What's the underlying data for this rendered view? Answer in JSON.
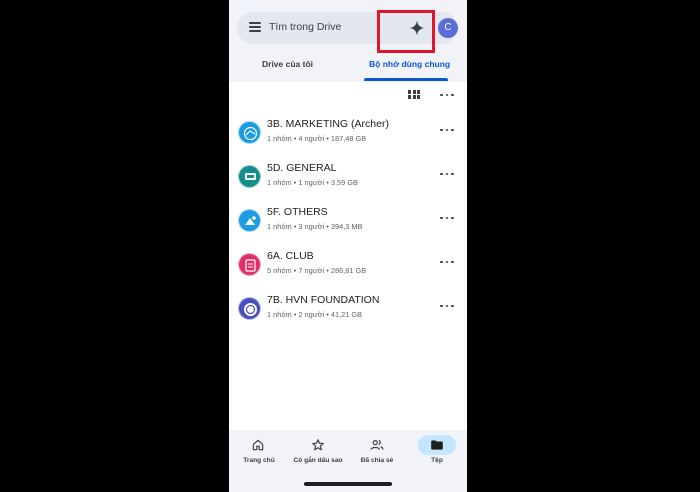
{
  "search": {
    "placeholder": "Tìm trong Drive",
    "avatar_letter": "C"
  },
  "tabs": [
    {
      "label": "Drive của tôi",
      "active": false
    },
    {
      "label": "Bộ nhớ dùng chung",
      "active": true
    }
  ],
  "toolbar": {
    "view_icon": "grid-view-icon",
    "more_icon": "more-horiz-icon"
  },
  "shared_drives": [
    {
      "name": "3B. MARKETING (Archer)",
      "meta": "1 nhóm • 4 người • 187,48 GB",
      "icon_color": "#1a9de0",
      "icon_text": ""
    },
    {
      "name": "5D. GENERAL",
      "meta": "1 nhóm • 1 người • 3,59 GB",
      "icon_color": "#128f8b",
      "icon_text": ""
    },
    {
      "name": "5F. OTHERS",
      "meta": "1 nhóm • 3 người • 394,3 MB",
      "icon_color": "#1d9be3",
      "icon_text": ""
    },
    {
      "name": "6A. CLUB",
      "meta": "5 nhóm • 7 người • 286,81 GB",
      "icon_color": "#e0306a",
      "icon_text": ""
    },
    {
      "name": "7B. HVN FOUNDATION",
      "meta": "1 nhóm • 2 người • 41,21 GB",
      "icon_color": "#4a4fbf",
      "icon_text": ""
    }
  ],
  "bottom_nav": [
    {
      "label": "Trang chủ",
      "icon": "home-icon",
      "active": false
    },
    {
      "label": "Có gắn dấu sao",
      "icon": "star-icon",
      "active": false
    },
    {
      "label": "Đã chia sẻ",
      "icon": "people-icon",
      "active": false
    },
    {
      "label": "Tệp",
      "icon": "folder-icon",
      "active": true
    }
  ],
  "colors": {
    "accent": "#0b57d0",
    "highlight_box": "#e0142b",
    "nav_active_pill": "#c2e7ff"
  }
}
